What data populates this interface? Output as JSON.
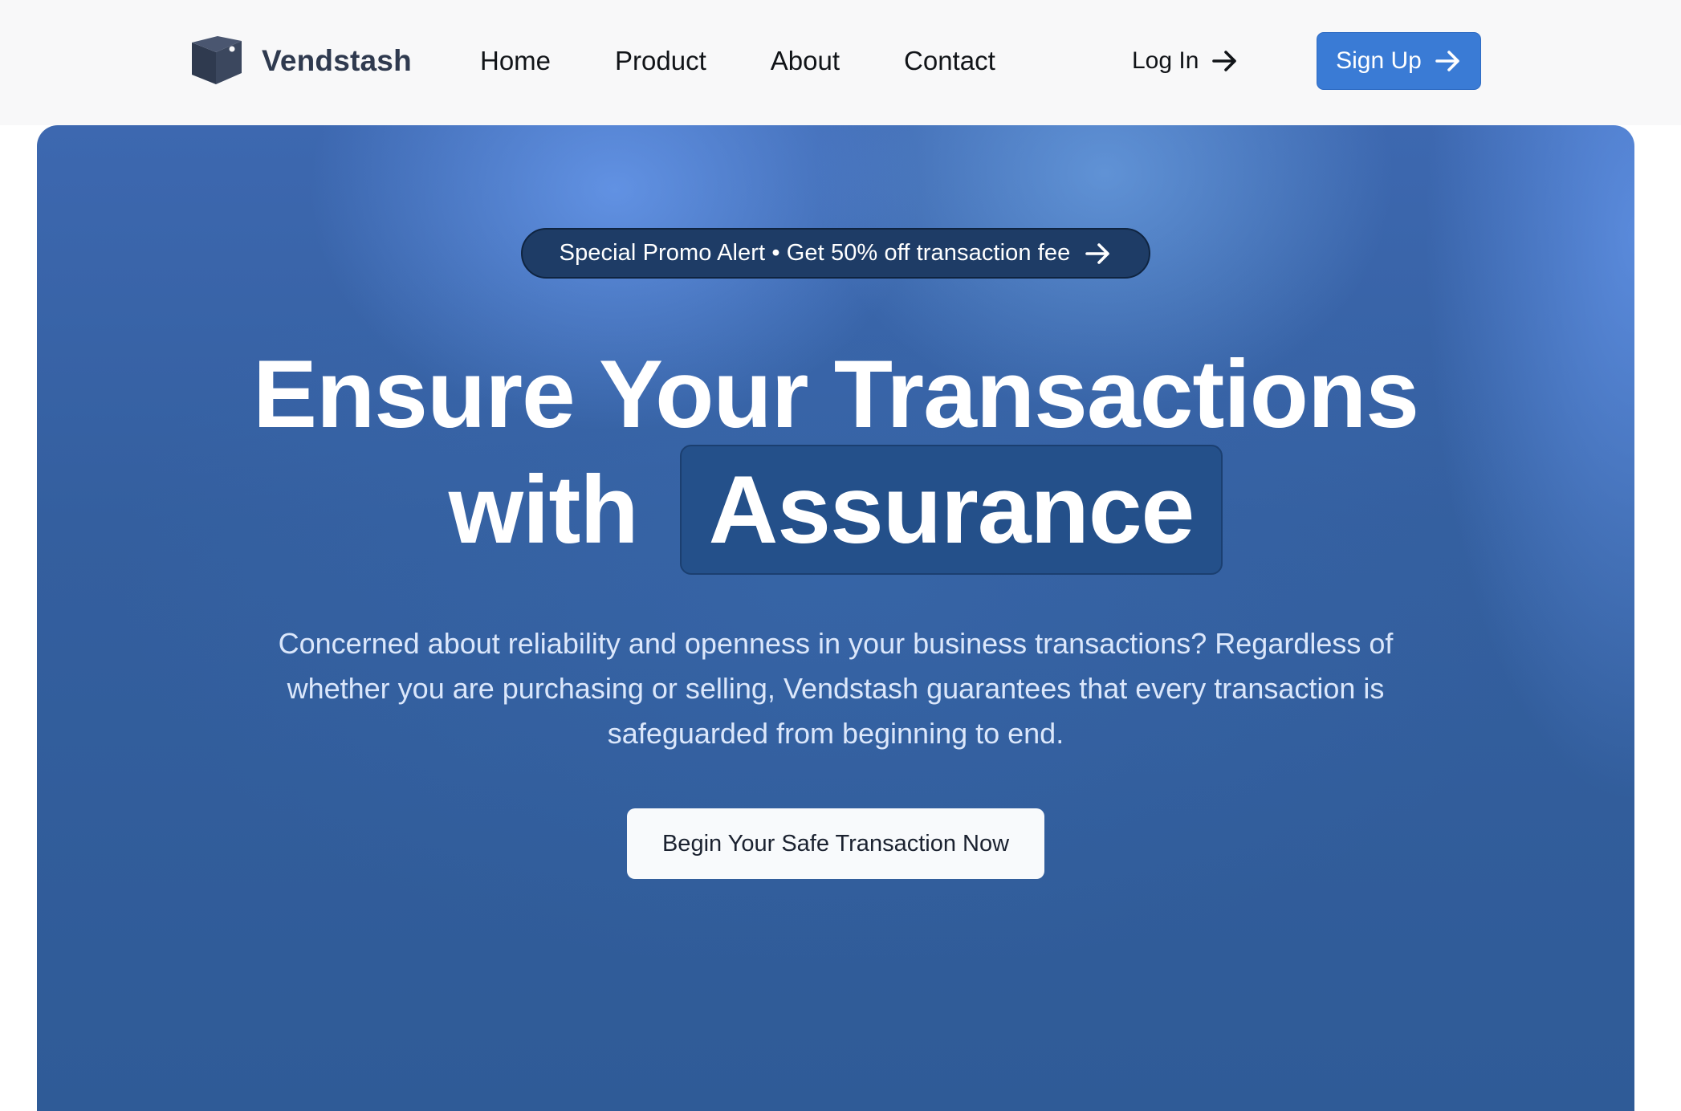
{
  "navbar": {
    "brand": "Vendstash",
    "links": [
      "Home",
      "Product",
      "About",
      "Contact"
    ],
    "login_label": "Log In",
    "signup_label": "Sign Up"
  },
  "hero": {
    "promo": "Special Promo Alert • Get 50% off transaction fee",
    "headline_line1": "Ensure Your Transactions",
    "headline_with": "with",
    "headline_highlight": "Assurance",
    "subtitle": "Concerned about reliability and openness in your business transactions? Regardless of whether you are purchasing or selling, Vendstash guarantees that every transaction is safeguarded from beginning to end.",
    "cta_label": "Begin Your Safe Transaction Now"
  },
  "icons": {
    "logo": "vault-box-icon",
    "login_arrow": "arrow-right-icon",
    "signup_arrow": "arrow-right-icon",
    "promo_arrow": "arrow-right-icon"
  },
  "colors": {
    "brand_text": "#2f3a4f",
    "primary_button": "#3a7bd5",
    "hero_background": "#345f9f",
    "promo_pill": "#1e3c66",
    "highlight_box": "#24508a",
    "cta_background": "#f8fafc"
  }
}
